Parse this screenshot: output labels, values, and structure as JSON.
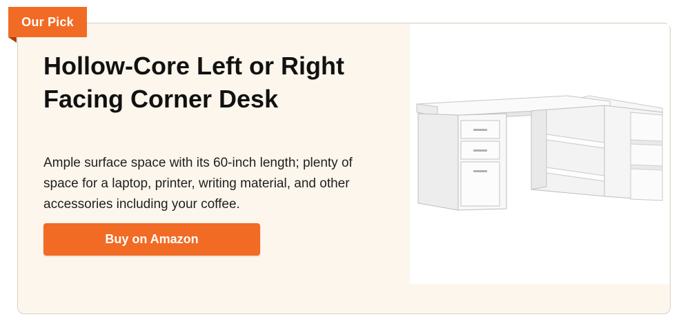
{
  "badge": {
    "label": "Our Pick"
  },
  "product": {
    "title": "Hollow-Core Left or Right Facing Corner Desk",
    "description": "Ample surface space with its 60-inch length; plenty of space for a laptop, printer, writing material, and other accessories including your coffee.",
    "image_alt": "White L-shaped corner desk with drawers and open shelves"
  },
  "cta": {
    "label": "Buy on Amazon"
  },
  "colors": {
    "accent": "#f26b24",
    "card_background": "#fcf6ec",
    "title_text": "#111111"
  }
}
